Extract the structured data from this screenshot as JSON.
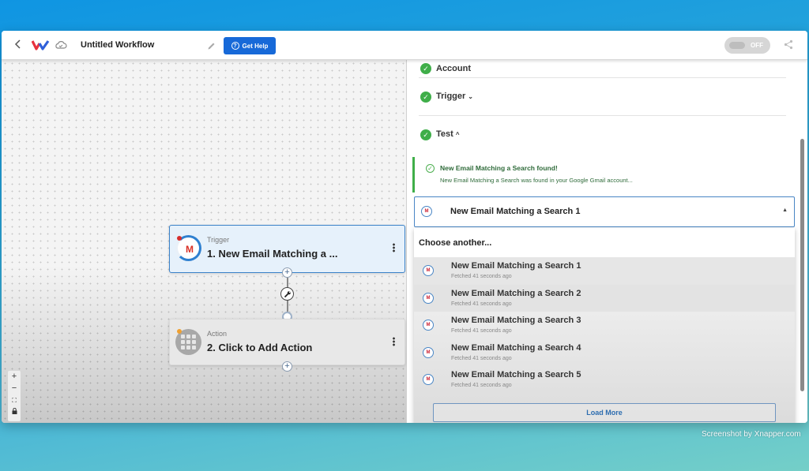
{
  "header": {
    "back_icon": "chevron-left-icon",
    "logo": "W",
    "title": "Untitled Workflow",
    "help_label": "Get Help",
    "toggle_label": "OFF",
    "toggle_state": "off"
  },
  "canvas": {
    "nodes": [
      {
        "kind": "Trigger",
        "name": "1. New Email Matching a ...",
        "app_icon": "gmail-icon",
        "status_color": "#d62d2d"
      },
      {
        "kind": "Action",
        "name": "2. Click to Add Action",
        "app_icon": "grid-icon",
        "status_color": "#f0a030"
      }
    ],
    "zoom_controls": [
      "+",
      "−",
      "⛶",
      "🔒"
    ]
  },
  "panel": {
    "sections": [
      {
        "label": "Account",
        "state": "done"
      },
      {
        "label": "Trigger",
        "state": "done",
        "chevron": "⌄"
      },
      {
        "label": "Test",
        "state": "done",
        "chevron": "^"
      }
    ],
    "success": {
      "title": "New Email Matching a Search found!",
      "message": "New Email Matching a Search was found in your Google Gmail account..."
    },
    "select": {
      "value": "New Email Matching a Search 1"
    },
    "dropdown": {
      "header": "Choose another...",
      "options": [
        {
          "title": "New Email Matching a Search 1",
          "sub": "Fetched 41 seconds ago"
        },
        {
          "title": "New Email Matching a Search 2",
          "sub": "Fetched 41 seconds ago"
        },
        {
          "title": "New Email Matching a Search 3",
          "sub": "Fetched 41 seconds ago"
        },
        {
          "title": "New Email Matching a Search 4",
          "sub": "Fetched 41 seconds ago"
        },
        {
          "title": "New Email Matching a Search 5",
          "sub": "Fetched 41 seconds ago"
        }
      ],
      "load_more": "Load More"
    }
  },
  "colors": {
    "primary": "#1769d8",
    "success": "#3fae49",
    "selected_border": "#4a86c5"
  },
  "watermark": "Screenshot by Xnapper.com"
}
